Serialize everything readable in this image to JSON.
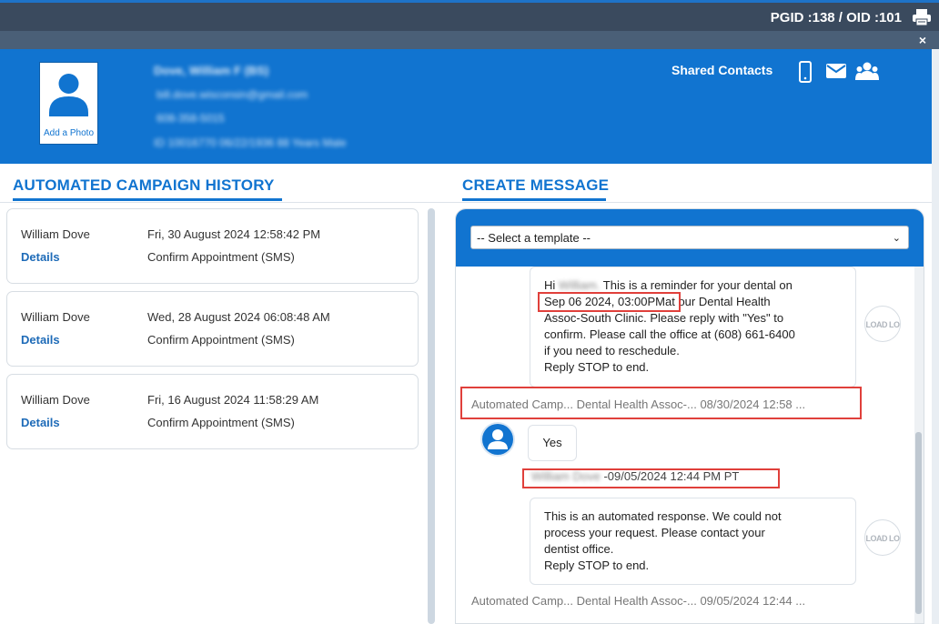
{
  "topbar": {
    "ids_label": "PGID :138  /  OID :101",
    "print_icon": "printer-icon",
    "close_icon": "×"
  },
  "patient": {
    "add_photo_label": "Add a Photo",
    "name": "Dove, William F (BS)",
    "email": "bill.dove.wisconsin@gmail.com",
    "phone": "608-358-5015",
    "id_line": "ID 10016770    06/22/1936    88 Years    Male",
    "shared_contacts_label": "Shared Contacts",
    "icons": [
      "mobile-icon",
      "mail-icon",
      "group-icon"
    ]
  },
  "history": {
    "title": "AUTOMATED CAMPAIGN HISTORY",
    "items": [
      {
        "name": "William Dove",
        "date": "Fri, 30 August 2024 12:58:42 PM",
        "link": "Details",
        "campaign": "Confirm Appointment (SMS)"
      },
      {
        "name": "William Dove",
        "date": "Wed, 28 August 2024 06:08:48 AM",
        "link": "Details",
        "campaign": "Confirm Appointment (SMS)"
      },
      {
        "name": "William Dove",
        "date": "Fri, 16 August 2024 11:58:29 AM",
        "link": "Details",
        "campaign": "Confirm Appointment (SMS)"
      }
    ]
  },
  "message": {
    "title": "CREATE MESSAGE",
    "template_placeholder": "-- Select a template --",
    "messages": [
      {
        "greeting": "Hi",
        "redacted_name": "William.",
        "line1_rest": "This is a reminder for your dental on",
        "highlight": "Sep 06 2024, 03:00PM",
        "line2_rest": "at our Dental Health",
        "rest": "Assoc-South Clinic. Please reply with \"Yes\" to\nconfirm. Please call the office at (608) 661-6400\nif you need to reschedule.\nReply STOP to end.",
        "meta": "Automated Camp...  Dental Health Assoc-...  08/30/2024 12:58 ...",
        "badge": "LOAD LO"
      },
      {
        "reply": "Yes",
        "reply_sender": "William Dove",
        "reply_meta": " -09/05/2024 12:44 PM PT"
      },
      {
        "text": "This is an automated response. We could not\nprocess your request. Please contact your\ndentist office.\nReply STOP to end.",
        "meta": "Automated Camp...  Dental Health Assoc-...  09/05/2024 12:44 ...",
        "badge": "LOAD LO"
      }
    ]
  }
}
